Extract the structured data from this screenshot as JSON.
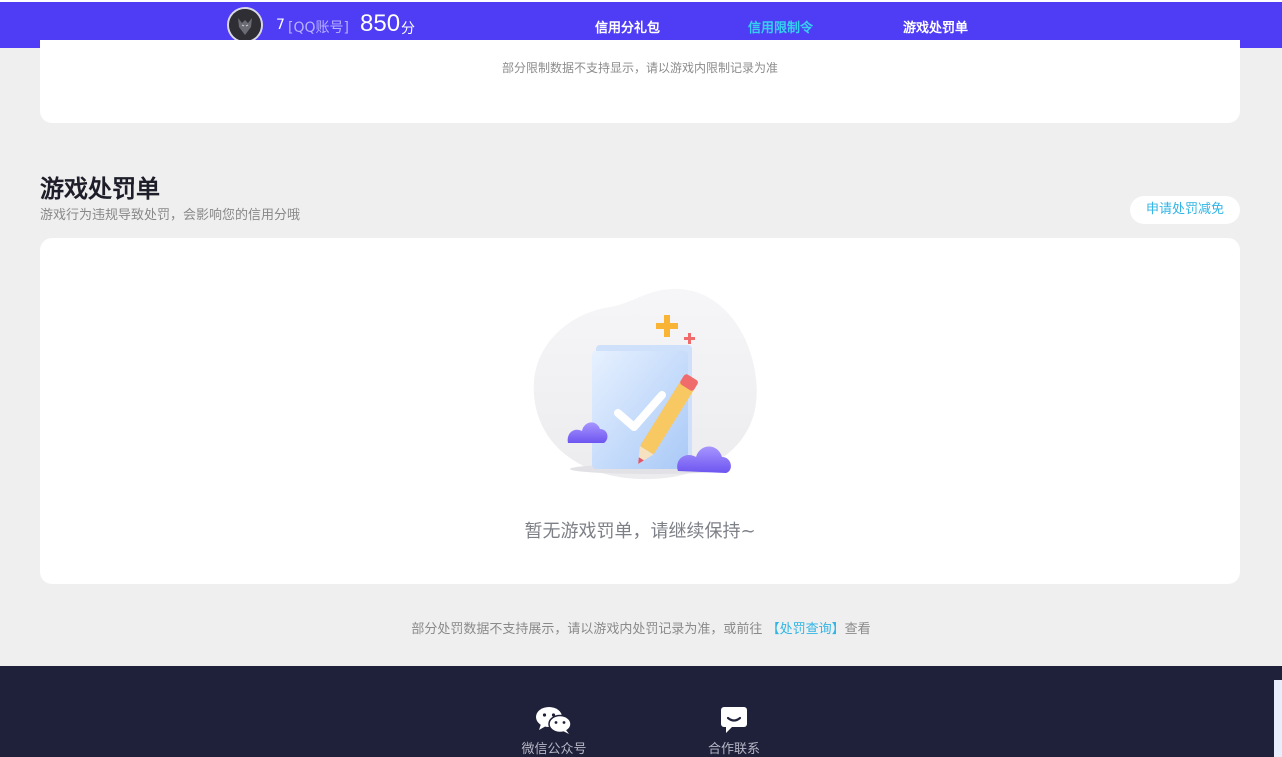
{
  "header": {
    "user_name": "7",
    "account_type": "[QQ账号]",
    "score": "850",
    "score_unit": "分",
    "nav": [
      {
        "label": "信用分礼包",
        "active": false
      },
      {
        "label": "信用限制令",
        "active": true
      },
      {
        "label": "游戏处罚单",
        "active": false
      }
    ],
    "colors": {
      "bar": "#4f3cf5",
      "active": "#35d0f0"
    }
  },
  "restriction_card": {
    "note": "部分限制数据不支持显示，请以游戏内限制记录为准"
  },
  "penalty_section": {
    "title": "游戏处罚单",
    "subtitle": "游戏行为违规导致处罚，会影响您的信用分哦",
    "appeal_button": "申请处罚减免",
    "empty_message": "暂无游戏罚单，请继续保持~",
    "note_prefix": "部分处罚数据不支持展示，请以游戏内处罚记录为准，或前往",
    "note_link": "【处罚查询】",
    "note_suffix": "查看"
  },
  "footer": {
    "items": [
      {
        "label": "微信公众号",
        "icon": "wechat-icon"
      },
      {
        "label": "合作联系",
        "icon": "chat-bubble-icon"
      }
    ]
  }
}
